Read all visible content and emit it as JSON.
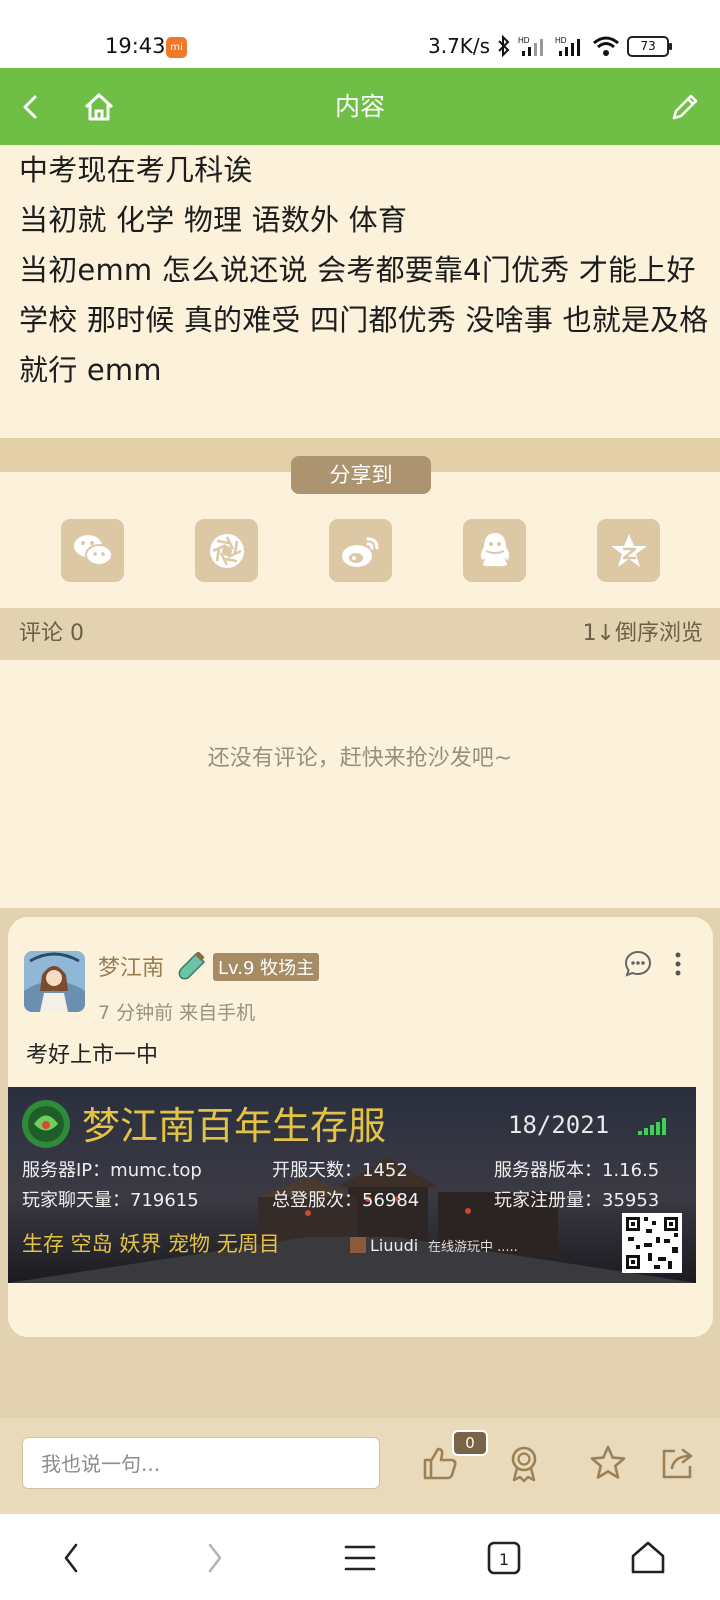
{
  "status_bar": {
    "time": "19:43",
    "mi_badge": "mi",
    "net_speed": "3.7K/s",
    "hd1": "HD",
    "hd2": "HD",
    "battery": "73"
  },
  "app_bar": {
    "title": "内容",
    "back_icon": "chevron-left-icon",
    "home_icon": "home-icon",
    "edit_icon": "pencil-icon"
  },
  "article": {
    "lines": [
      "中考现在考几科诶",
      "当初就 化学 物理 语数外 体育",
      "当初emm 怎么说还说 会考都要靠4门优秀 才能上好学校 那时候 真的难受 四门都优秀 没啥事 也就是及格就行 emm"
    ]
  },
  "share": {
    "label": "分享到",
    "buttons": [
      "wechat-icon",
      "moments-icon",
      "weibo-icon",
      "qq-icon",
      "qzone-icon"
    ]
  },
  "comments": {
    "count_label": "评论 0",
    "sort_label": "1↓倒序浏览",
    "empty_text": "还没有评论，赶快来抢沙发吧~"
  },
  "post_card": {
    "username": "梦江南",
    "level": "Lv.9 牧场主",
    "meta": "7 分钟前 来自手机",
    "text": "考好上市一中",
    "banner": {
      "title": "梦江南百年生存服",
      "online": "18/2021",
      "ip": "服务器IP：mumc.top",
      "days": "开服天数：1452",
      "version": "服务器版本：1.16.5",
      "chat": "玩家聊天量：719615",
      "logins": "总登服次：56984",
      "registered": "玩家注册量：35953",
      "tags": "生存 空岛 妖界 宠物 无周目",
      "player": "Liuudi",
      "player_status": "在线游玩中 ....."
    }
  },
  "reply_bar": {
    "placeholder": "我也说一句...",
    "like_count": "0"
  },
  "system_nav": {
    "tab_count": "1"
  },
  "colors": {
    "accent_green": "#6fbe45",
    "cream": "#fcf2dc",
    "tan": "#e3d2b0",
    "brown": "#ad9470"
  }
}
